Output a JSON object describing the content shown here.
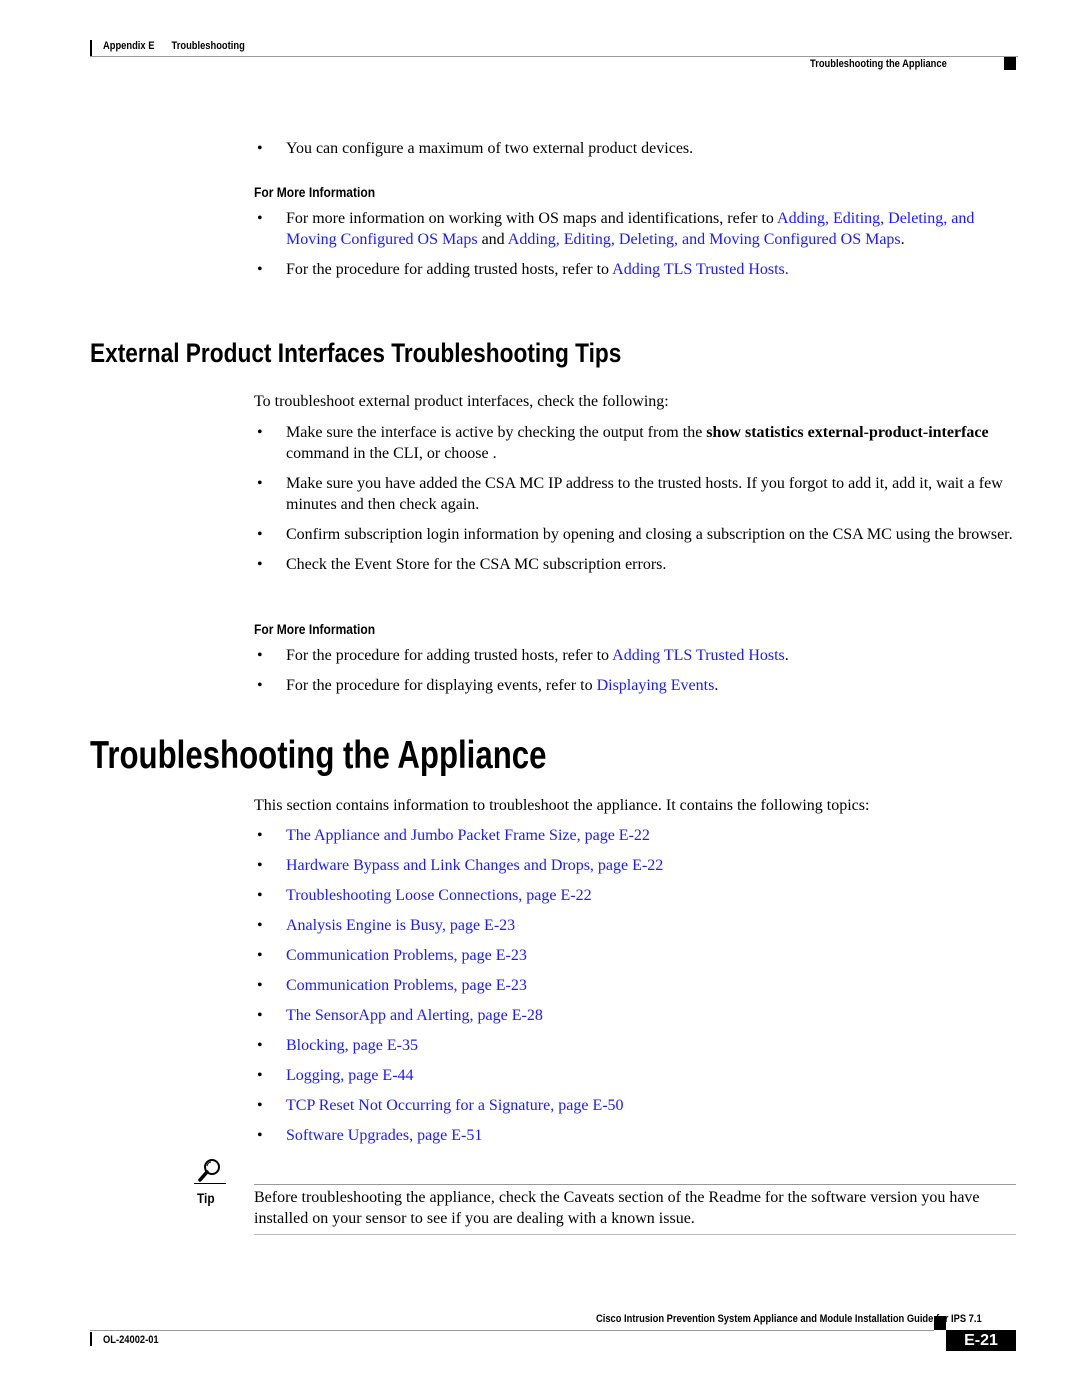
{
  "header": {
    "left_chapter": "Appendix E",
    "left_title": "Troubleshooting",
    "right_section": "Troubleshooting the Appliance"
  },
  "intro_bullet": "You can configure a maximum of two external product devices.",
  "more_info_1": {
    "heading": "For More Information",
    "items": [
      {
        "pre": "For more information on working with OS maps and identifications, refer to ",
        "link1": "Adding, Editing, Deleting, and Moving Configured OS Maps",
        "mid": " and ",
        "link2": "Adding, Editing, Deleting, and Moving Configured OS Maps",
        "post": "."
      },
      {
        "pre": "For the procedure for adding trusted hosts, refer to ",
        "link1": "Adding TLS Trusted Hosts.",
        "post": ""
      }
    ]
  },
  "section_ext": {
    "title": "External Product Interfaces Troubleshooting Tips",
    "intro": "To troubleshoot external product interfaces, check the following:",
    "items": [
      {
        "pre": "Make sure the interface is active by checking the output from the ",
        "bold": "show statistics external-product-interface",
        "post": " command in the CLI, or choose ."
      },
      {
        "text": "Make sure you have added the CSA MC IP address to the trusted hosts. If you forgot to add it, add it, wait a few minutes and then check again."
      },
      {
        "text": "Confirm subscription login information by opening and closing a subscription on the CSA MC using the browser."
      },
      {
        "text": "Check the Event Store for the CSA MC subscription errors."
      }
    ],
    "more_info": {
      "heading": "For More Information",
      "items": [
        {
          "pre": "For the procedure for adding trusted hosts, refer to ",
          "link": "Adding TLS Trusted Hosts",
          "post": "."
        },
        {
          "pre": "For the procedure for displaying events, refer to ",
          "link": "Displaying Events",
          "post": "."
        }
      ]
    }
  },
  "section_appliance": {
    "title": "Troubleshooting the Appliance",
    "intro": "This section contains information to troubleshoot the appliance. It contains the following topics:",
    "topics": [
      "The Appliance and Jumbo Packet Frame Size, page E-22",
      "Hardware Bypass and Link Changes and Drops, page E-22",
      "Troubleshooting Loose Connections, page E-22",
      "Analysis Engine is Busy, page E-23",
      "Communication Problems, page E-23",
      "Communication Problems, page E-23",
      "The SensorApp and Alerting, page E-28",
      "Blocking, page E-35",
      "Logging, page E-44",
      "TCP Reset Not Occurring for a Signature, page E-50",
      "Software Upgrades, page E-51"
    ]
  },
  "tip": {
    "icon": "magnifier-icon",
    "label": "Tip",
    "text": "Before troubleshooting the appliance, check the Caveats section of the Readme for the software version you have installed on your sensor to see if you are dealing with a known issue."
  },
  "footer": {
    "guide_title": "Cisco Intrusion Prevention System Appliance and Module Installation Guide for IPS 7.1",
    "doc_number": "OL-24002-01",
    "page_number": "E-21"
  },
  "colors": {
    "link": "#1a1aff",
    "text": "#000000",
    "rule": "#999999"
  }
}
